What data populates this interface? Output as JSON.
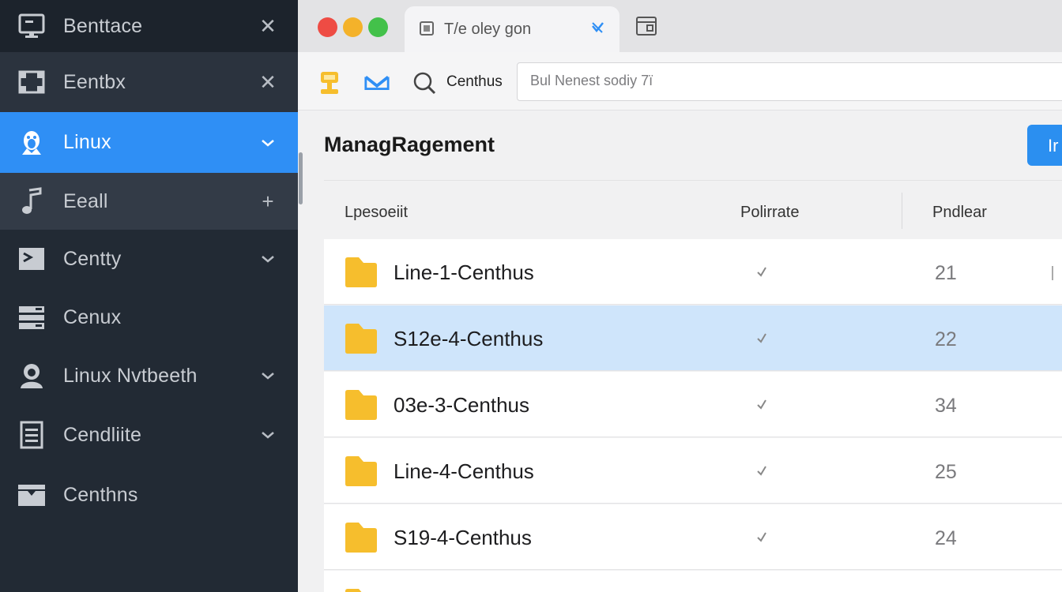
{
  "sidebar": {
    "items": [
      {
        "label": "Benttace",
        "icon": "monitor-icon",
        "trail": "close-icon",
        "state": "normal"
      },
      {
        "label": "Eentbx",
        "icon": "grid-frame-icon",
        "trail": "close-icon",
        "state": "normal"
      },
      {
        "label": "Linux",
        "icon": "linux-penguin-icon",
        "trail": "chevron-down-icon",
        "state": "active"
      },
      {
        "label": "Eeall",
        "icon": "music-note-icon",
        "trail": "plus-icon",
        "state": "hover"
      },
      {
        "label": "Centty",
        "icon": "terminal-icon",
        "trail": "chevron-down-icon",
        "state": "normal"
      },
      {
        "label": "Cenux",
        "icon": "server-icon",
        "trail": "",
        "state": "normal"
      },
      {
        "label": "Linux Nvtbeeth",
        "icon": "user-icon",
        "trail": "chevron-down-icon",
        "state": "normal"
      },
      {
        "label": "Cendliite",
        "icon": "document-list-icon",
        "trail": "chevron-down-icon",
        "state": "normal"
      },
      {
        "label": "Centhns",
        "icon": "inbox-tray-icon",
        "trail": "",
        "state": "normal"
      }
    ]
  },
  "browser": {
    "tab_title": "T/e oley gon",
    "tab_icon": "page-icon",
    "tab_close_icon": "close-icon",
    "new_tab_icon": "window-icon"
  },
  "toolbar": {
    "label": "Centhus",
    "url_placeholder": "Bul Nenest sodiy 7ï",
    "icons": [
      "lamp-icon",
      "mail-icon",
      "search-icon"
    ]
  },
  "main": {
    "title": "ManagRagement",
    "primary_button": "Ir",
    "columns": [
      "Lpesoeiit",
      "Polirrate",
      "Pndlear"
    ],
    "rows": [
      {
        "name": "Line-1-Centhus",
        "checked": true,
        "value": "21",
        "selected": false
      },
      {
        "name": "S12e-4-Centhus",
        "checked": true,
        "value": "22",
        "selected": true
      },
      {
        "name": "03e-3-Centhus",
        "checked": true,
        "value": "34",
        "selected": false
      },
      {
        "name": "Line-4-Centhus",
        "checked": true,
        "value": "25",
        "selected": false
      },
      {
        "name": "S19-4-Centhus",
        "checked": true,
        "value": "24",
        "selected": false
      }
    ]
  },
  "colors": {
    "sidebar_bg": "#222a34",
    "sidebar_active": "#2f8ff5",
    "row_selected": "#cfe5fb",
    "folder": "#f6be2d",
    "accent": "#2b8ff0"
  }
}
